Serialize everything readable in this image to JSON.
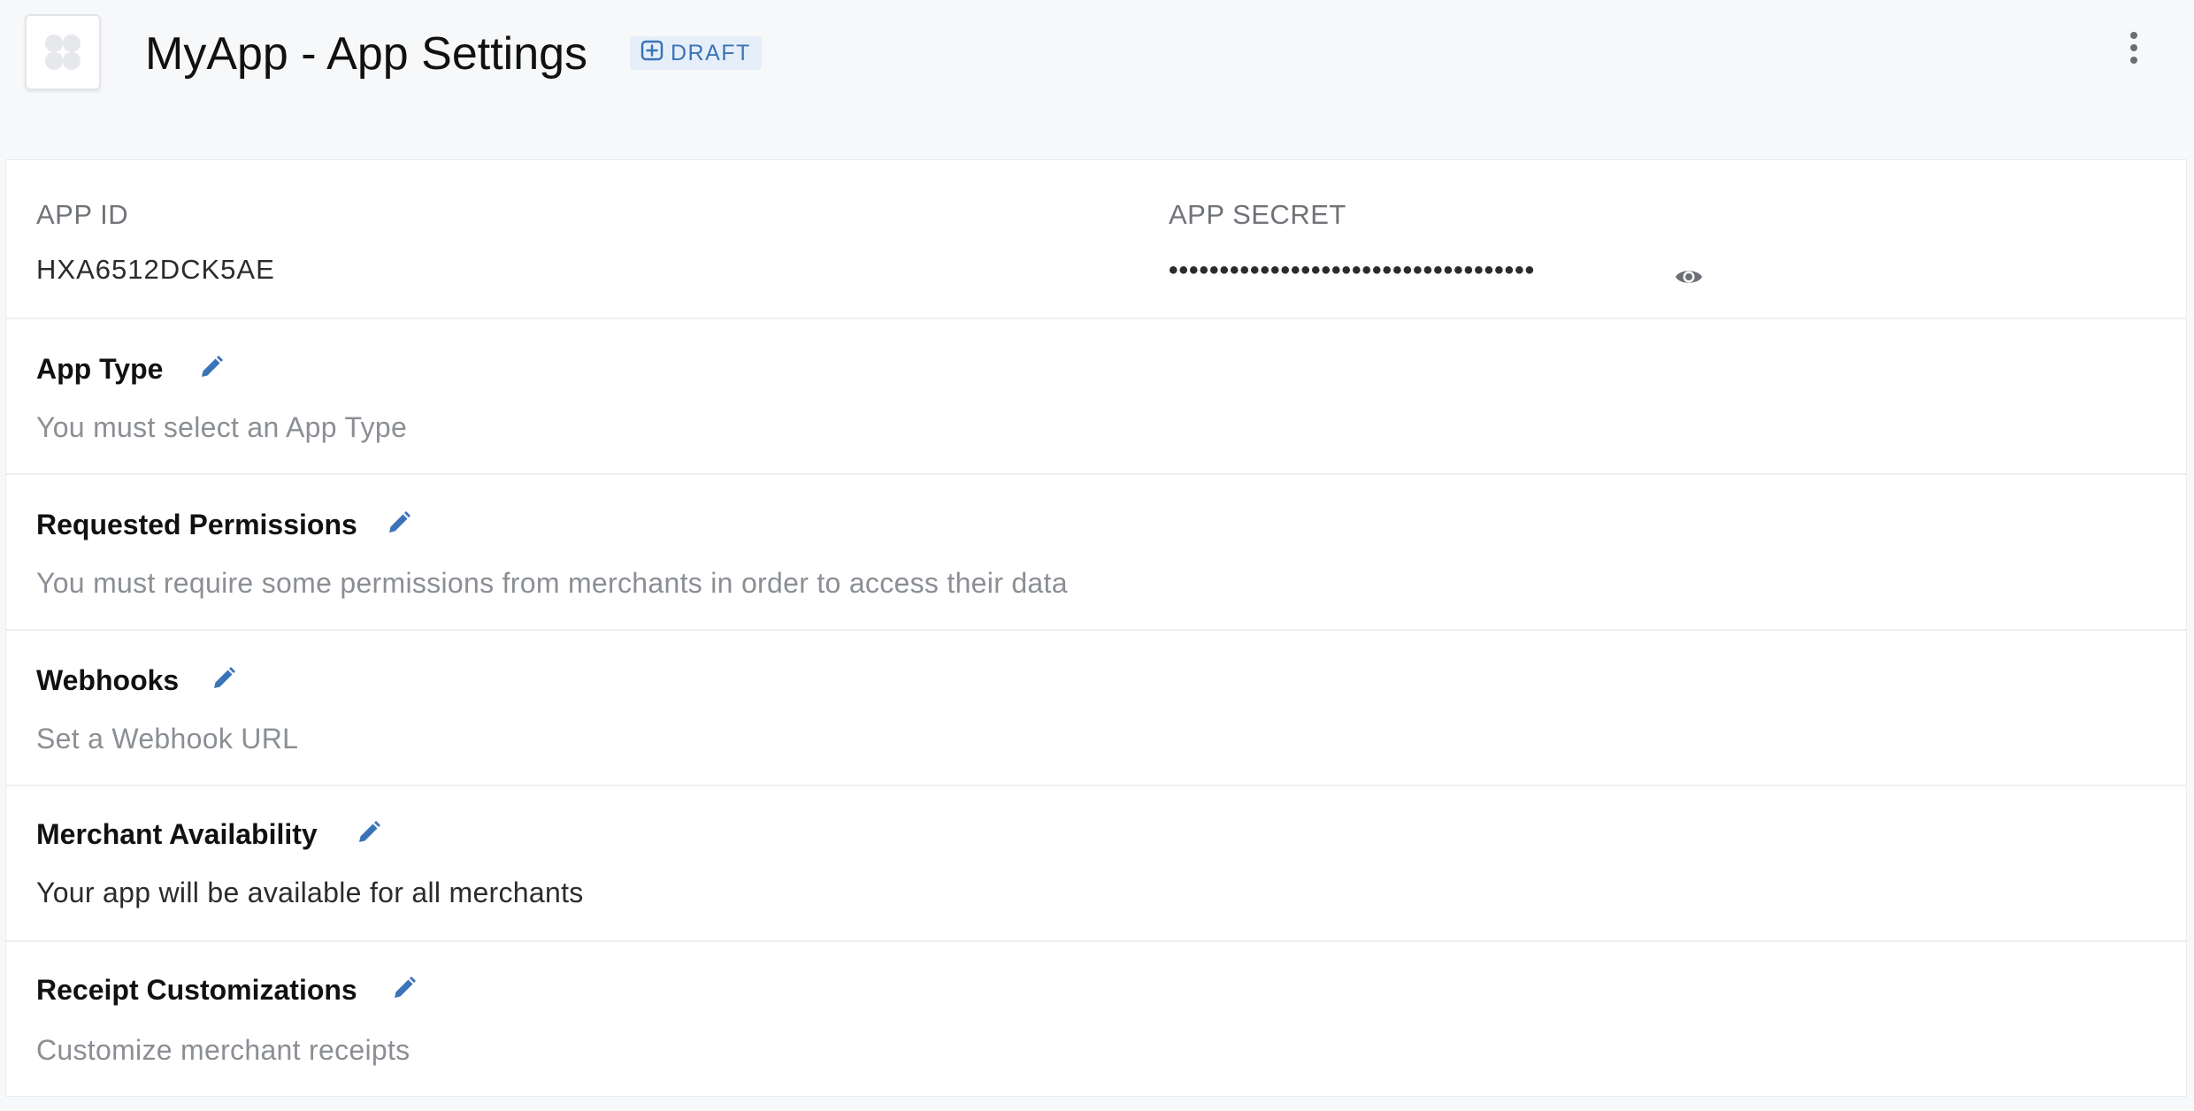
{
  "header": {
    "app_icon": "app-placeholder-icon",
    "title": "MyApp - App Settings",
    "badge_icon": "plus-box-icon",
    "badge_label": "DRAFT",
    "more_icon": "more-vertical-icon"
  },
  "credentials": {
    "app_id_label": "APP ID",
    "app_id_value": "HXA6512DCK5AE",
    "app_secret_label": "APP SECRET",
    "app_secret_value": "••••••••••••••••••••••••••••••••••••",
    "reveal_icon": "eye-icon"
  },
  "sections": {
    "app_type": {
      "title": "App Type",
      "description": "You must select an App Type",
      "edit_icon": "pencil-icon"
    },
    "permissions": {
      "title": "Requested Permissions",
      "description": "You must require some permissions from merchants in order to access their data",
      "edit_icon": "pencil-icon"
    },
    "webhooks": {
      "title": "Webhooks",
      "description": "Set a Webhook URL",
      "edit_icon": "pencil-icon"
    },
    "availability": {
      "title": "Merchant Availability",
      "description": "Your app will be available for all merchants",
      "edit_icon": "pencil-icon"
    },
    "receipts": {
      "title": "Receipt Customizations",
      "description": "Customize merchant receipts",
      "edit_icon": "pencil-icon"
    }
  },
  "colors": {
    "accent": "#3a73b8",
    "badge_bg": "#e6eff9",
    "muted_text": "#8b8f94"
  }
}
